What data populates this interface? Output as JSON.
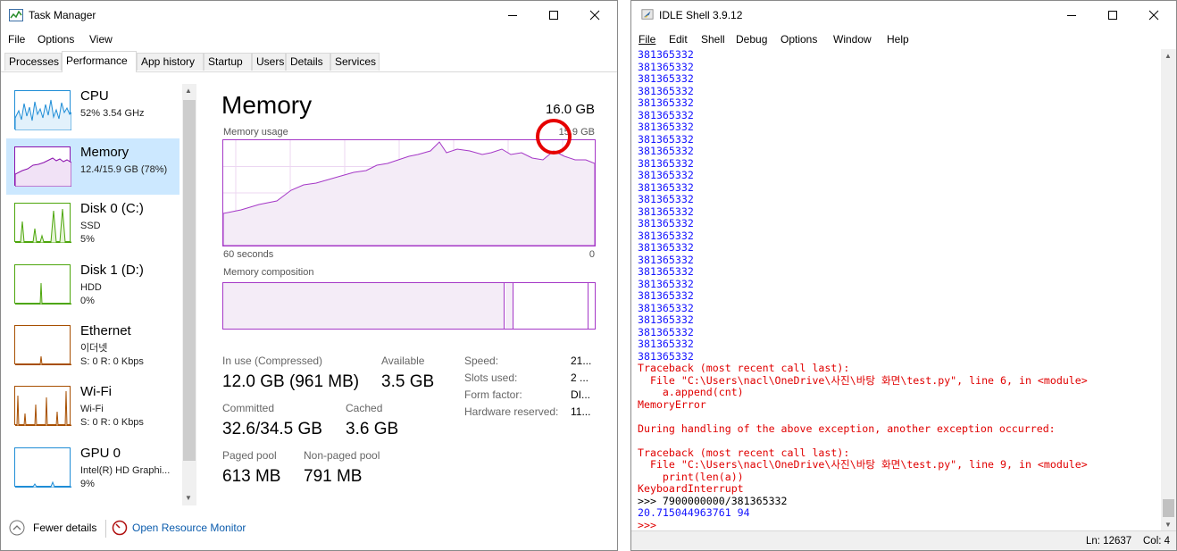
{
  "task_manager": {
    "title": "Task Manager",
    "menu": [
      "File",
      "Options",
      "View"
    ],
    "tabs": [
      "Processes",
      "Performance",
      "App history",
      "Startup",
      "Users",
      "Details",
      "Services"
    ],
    "active_tab": "Performance",
    "sidebar": [
      {
        "name": "CPU",
        "sub1": "52% 3.54 GHz",
        "sub2": "",
        "color": "#1f8dd6"
      },
      {
        "name": "Memory",
        "sub1": "12.4/15.9 GB (78%)",
        "sub2": "",
        "color": "#8b12ae"
      },
      {
        "name": "Disk 0 (C:)",
        "sub1": "SSD",
        "sub2": "5%",
        "color": "#4da60c"
      },
      {
        "name": "Disk 1 (D:)",
        "sub1": "HDD",
        "sub2": "0%",
        "color": "#4da60c"
      },
      {
        "name": "Ethernet",
        "sub1": "이더넷",
        "sub2": "S: 0 R: 0 Kbps",
        "color": "#a74f01"
      },
      {
        "name": "Wi-Fi",
        "sub1": "Wi-Fi",
        "sub2": "S: 0 R: 0 Kbps",
        "color": "#a74f01"
      },
      {
        "name": "GPU 0",
        "sub1": "Intel(R) HD Graphi...",
        "sub2": "9%",
        "color": "#1f8dd6"
      }
    ],
    "main": {
      "title": "Memory",
      "total": "16.0 GB",
      "usage_label": "Memory usage",
      "usage_max": "15.9 GB",
      "time_left": "60 seconds",
      "time_right": "0",
      "composition_label": "Memory composition",
      "stats": {
        "in_use_label": "In use (Compressed)",
        "in_use_value": "12.0 GB (961 MB)",
        "available_label": "Available",
        "available_value": "3.5 GB",
        "committed_label": "Committed",
        "committed_value": "32.6/34.5 GB",
        "cached_label": "Cached",
        "cached_value": "3.6 GB",
        "paged_label": "Paged pool",
        "paged_value": "613 MB",
        "nonpaged_label": "Non-paged pool",
        "nonpaged_value": "791 MB"
      },
      "details": [
        {
          "label": "Speed:",
          "value": "21..."
        },
        {
          "label": "Slots used:",
          "value": "2 ..."
        },
        {
          "label": "Form factor:",
          "value": "DI..."
        },
        {
          "label": "Hardware reserved:",
          "value": "11..."
        }
      ],
      "accent": "#a538c7"
    },
    "footer": {
      "fewer_details": "Fewer details",
      "open_monitor": "Open Resource Monitor"
    }
  },
  "idle": {
    "title": "IDLE Shell 3.9.12",
    "menu": [
      "File",
      "Edit",
      "Shell",
      "Debug",
      "Options",
      "Window",
      "Help"
    ],
    "shell_lines": [
      {
        "type": "out",
        "text": "381365332"
      },
      {
        "type": "out",
        "text": "381365332"
      },
      {
        "type": "out",
        "text": "381365332"
      },
      {
        "type": "out",
        "text": "381365332"
      },
      {
        "type": "out",
        "text": "381365332"
      },
      {
        "type": "out",
        "text": "381365332"
      },
      {
        "type": "out",
        "text": "381365332"
      },
      {
        "type": "out",
        "text": "381365332"
      },
      {
        "type": "out",
        "text": "381365332"
      },
      {
        "type": "out",
        "text": "381365332"
      },
      {
        "type": "out",
        "text": "381365332"
      },
      {
        "type": "out",
        "text": "381365332"
      },
      {
        "type": "out",
        "text": "381365332"
      },
      {
        "type": "out",
        "text": "381365332"
      },
      {
        "type": "out",
        "text": "381365332"
      },
      {
        "type": "out",
        "text": "381365332"
      },
      {
        "type": "out",
        "text": "381365332"
      },
      {
        "type": "out",
        "text": "381365332"
      },
      {
        "type": "out",
        "text": "381365332"
      },
      {
        "type": "out",
        "text": "381365332"
      },
      {
        "type": "out",
        "text": "381365332"
      },
      {
        "type": "out",
        "text": "381365332"
      },
      {
        "type": "out",
        "text": "381365332"
      },
      {
        "type": "out",
        "text": "381365332"
      },
      {
        "type": "out",
        "text": "381365332"
      },
      {
        "type": "out",
        "text": "381365332"
      },
      {
        "type": "err",
        "text": "Traceback (most recent call last):"
      },
      {
        "type": "err",
        "text": "  File \"C:\\Users\\nacl\\OneDrive\\사진\\바탕 화면\\test.py\", line 6, in <module>"
      },
      {
        "type": "err",
        "text": "    a.append(cnt)"
      },
      {
        "type": "err",
        "text": "MemoryError"
      },
      {
        "type": "err",
        "text": ""
      },
      {
        "type": "err",
        "text": "During handling of the above exception, another exception occurred:"
      },
      {
        "type": "err",
        "text": ""
      },
      {
        "type": "err",
        "text": "Traceback (most recent call last):"
      },
      {
        "type": "err",
        "text": "  File \"C:\\Users\\nacl\\OneDrive\\사진\\바탕 화면\\test.py\", line 9, in <module>"
      },
      {
        "type": "err",
        "text": "    print(len(a))"
      },
      {
        "type": "err",
        "text": "KeyboardInterrupt"
      },
      {
        "type": "in",
        "text": ">>> 7900000000/381365332"
      },
      {
        "type": "out",
        "text": "20.715044963761 94"
      },
      {
        "type": "err",
        "text": ">>>"
      }
    ],
    "status": {
      "ln": "Ln: 12637",
      "col": "Col: 4"
    }
  }
}
